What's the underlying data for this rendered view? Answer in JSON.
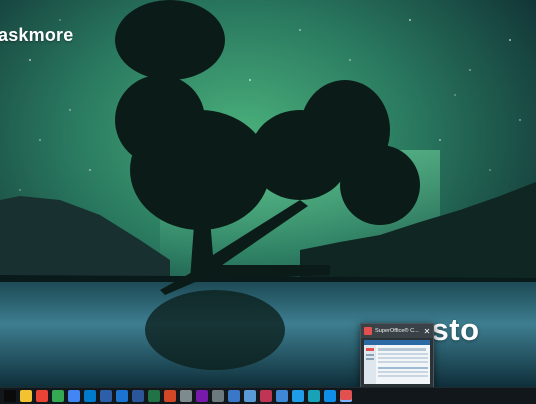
{
  "desktop": {
    "wallpaper_description": "Night lake with tree under a green starry sky",
    "brand_top_left": "askmore",
    "brand_bottom_right": "amesto"
  },
  "taskbar_preview": {
    "title": "SuperOffice® C...",
    "close_glyph": "✕"
  },
  "taskbar": {
    "icons": [
      {
        "name": "start-icon",
        "color": "#0a0a0a"
      },
      {
        "name": "chrome-icon-1",
        "color": "#f2c230"
      },
      {
        "name": "chrome-icon-2",
        "color": "#ea4335"
      },
      {
        "name": "chrome-icon-3",
        "color": "#34a853"
      },
      {
        "name": "chrome-icon-4",
        "color": "#4285f4"
      },
      {
        "name": "vscode-icon",
        "color": "#007acc"
      },
      {
        "name": "powershell-icon",
        "color": "#2f5ea8"
      },
      {
        "name": "onedrive-icon",
        "color": "#1d74d0"
      },
      {
        "name": "word-icon",
        "color": "#2b579a"
      },
      {
        "name": "excel-icon",
        "color": "#217346"
      },
      {
        "name": "powerpoint-icon",
        "color": "#d24726"
      },
      {
        "name": "files-icon",
        "color": "#7d8b8f"
      },
      {
        "name": "onenote-icon",
        "color": "#7719aa"
      },
      {
        "name": "window-icon",
        "color": "#6c7a80"
      },
      {
        "name": "monitor-icon",
        "color": "#3a77c7"
      },
      {
        "name": "photos-icon",
        "color": "#5a9bd6"
      },
      {
        "name": "slack-icon",
        "color": "#c03554"
      },
      {
        "name": "app-icon-1",
        "color": "#3f88d6"
      },
      {
        "name": "app-icon-2",
        "color": "#1f9de6"
      },
      {
        "name": "app-icon-3",
        "color": "#17a2b8"
      },
      {
        "name": "teamviewer-icon",
        "color": "#0e8ee9"
      },
      {
        "name": "superoffice-icon",
        "color": "#e35050"
      }
    ]
  }
}
